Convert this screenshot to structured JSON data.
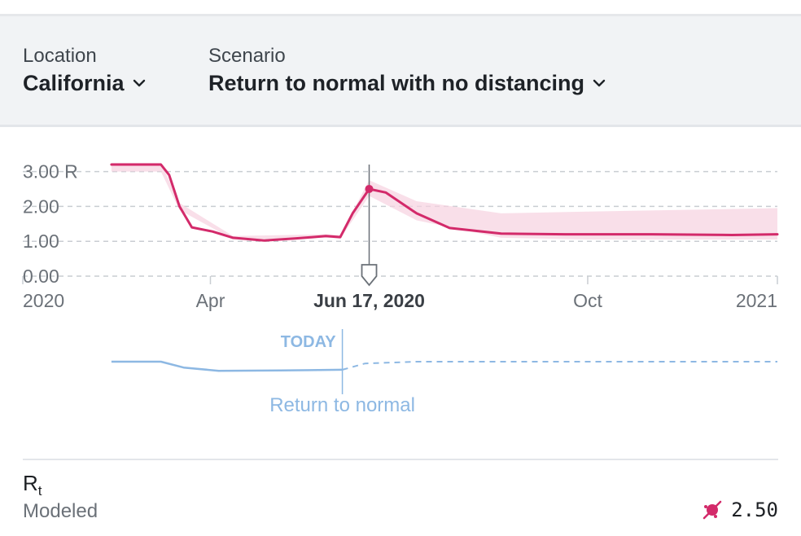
{
  "header": {
    "location": {
      "label": "Location",
      "value": "California"
    },
    "scenario": {
      "label": "Scenario",
      "value": "Return to normal with no distancing"
    }
  },
  "colors": {
    "accent": "#d32a6a",
    "band": "#f7d2e0",
    "scenario_line": "#8db8e3",
    "grid": "#c9cdd2"
  },
  "chart_data": {
    "type": "line",
    "title": "",
    "ylabel": "R",
    "yticks": [
      "3.00",
      "2.00",
      "1.00",
      "0.00"
    ],
    "ytick_suffix": "R",
    "xticks": [
      "2020",
      "Apr",
      "Oct",
      "2021"
    ],
    "xlim": [
      "2020-01-01",
      "2021-01-01"
    ],
    "ylim": [
      0,
      3.2
    ],
    "hover": {
      "date_label": "Jun 17, 2020",
      "date": "2020-06-17",
      "value": 2.5
    },
    "series": [
      {
        "name": "",
        "points": [
          [
            "2020-02-13",
            3.2
          ],
          [
            "2020-03-08",
            3.2
          ],
          [
            "2020-03-12",
            2.9
          ],
          [
            "2020-03-17",
            2.0
          ],
          [
            "2020-03-23",
            1.4
          ],
          [
            "2020-04-02",
            1.28
          ],
          [
            "2020-04-12",
            1.1
          ],
          [
            "2020-04-27",
            1.02
          ],
          [
            "2020-05-12",
            1.08
          ],
          [
            "2020-05-27",
            1.15
          ],
          [
            "2020-06-03",
            1.12
          ],
          [
            "2020-06-09",
            1.8
          ],
          [
            "2020-06-17",
            2.5
          ],
          [
            "2020-06-25",
            2.4
          ],
          [
            "2020-07-10",
            1.8
          ],
          [
            "2020-07-26",
            1.38
          ],
          [
            "2020-08-20",
            1.22
          ],
          [
            "2020-09-20",
            1.2
          ],
          [
            "2020-11-01",
            1.2
          ],
          [
            "2020-12-10",
            1.18
          ],
          [
            "2021-01-01",
            1.2
          ]
        ],
        "band": [
          [
            "2020-02-13",
            3.0,
            3.25
          ],
          [
            "2020-03-08",
            3.0,
            3.25
          ],
          [
            "2020-03-17",
            1.9,
            2.1
          ],
          [
            "2020-04-12",
            1.05,
            1.15
          ],
          [
            "2020-05-27",
            1.1,
            1.2
          ],
          [
            "2020-06-03",
            1.08,
            1.18
          ],
          [
            "2020-06-17",
            2.3,
            2.75
          ],
          [
            "2020-07-10",
            1.6,
            2.15
          ],
          [
            "2020-08-20",
            1.1,
            1.8
          ],
          [
            "2020-10-01",
            1.05,
            1.85
          ],
          [
            "2021-01-01",
            1.05,
            1.95
          ]
        ]
      }
    ],
    "scenario": {
      "today_label": "TODAY",
      "annotation": "Return to normal",
      "today": "2020-06-04",
      "history": [
        [
          "2020-02-13",
          1
        ],
        [
          "2020-03-08",
          1
        ],
        [
          "2020-03-19",
          0.6
        ],
        [
          "2020-04-05",
          0.38
        ],
        [
          "2020-05-05",
          0.4
        ],
        [
          "2020-06-04",
          0.45
        ]
      ],
      "projection": [
        [
          "2020-06-04",
          0.45
        ],
        [
          "2020-06-15",
          0.88
        ],
        [
          "2020-07-10",
          1
        ],
        [
          "2021-01-01",
          1
        ]
      ]
    }
  },
  "summary": {
    "metric_main": "R",
    "metric_sub": "t",
    "caption": "Modeled",
    "value": "2.50",
    "icon": "virus-icon"
  }
}
